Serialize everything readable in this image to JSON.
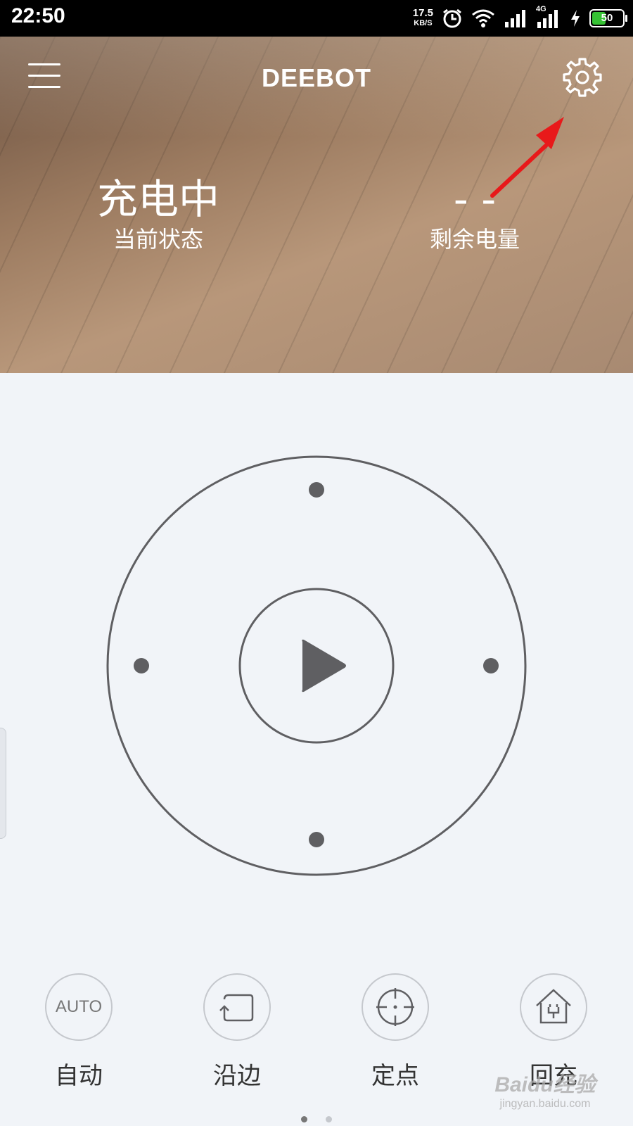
{
  "status_bar": {
    "time": "22:50",
    "speed_value": "17.5",
    "speed_unit": "KB/S",
    "network_type": "4G",
    "battery_level": "50",
    "battery_fraction": 0.5,
    "icons": [
      "alarm-icon",
      "wifi-icon",
      "signal-icon",
      "signal-4g-icon",
      "charging-icon",
      "battery-icon"
    ]
  },
  "header": {
    "title": "DEEBOT",
    "menu_icon": "hamburger-icon",
    "settings_icon": "gear-icon"
  },
  "stats": {
    "status_value": "充电中",
    "status_label": "当前状态",
    "battery_value": "- -",
    "battery_label": "剩余电量"
  },
  "control": {
    "center_icon": "play-icon",
    "direction_icons": [
      "up-dot",
      "down-dot",
      "left-dot",
      "right-dot"
    ]
  },
  "actions": [
    {
      "label": "自动",
      "icon_text": "AUTO",
      "icon": "auto-icon"
    },
    {
      "label": "沿边",
      "icon": "edge-icon"
    },
    {
      "label": "定点",
      "icon": "spot-icon"
    },
    {
      "label": "回充",
      "icon": "home-charge-icon"
    }
  ],
  "pager": {
    "count": 2,
    "active": 0
  },
  "watermark": {
    "main": "Baidu经验",
    "sub": "jingyan.baidu.com"
  },
  "colors": {
    "accent_red": "#e8191a",
    "icon_gray": "#5f5f62",
    "circle_border": "#c5c8cd",
    "background": "#f1f4f8",
    "battery_green": "#36c234"
  }
}
